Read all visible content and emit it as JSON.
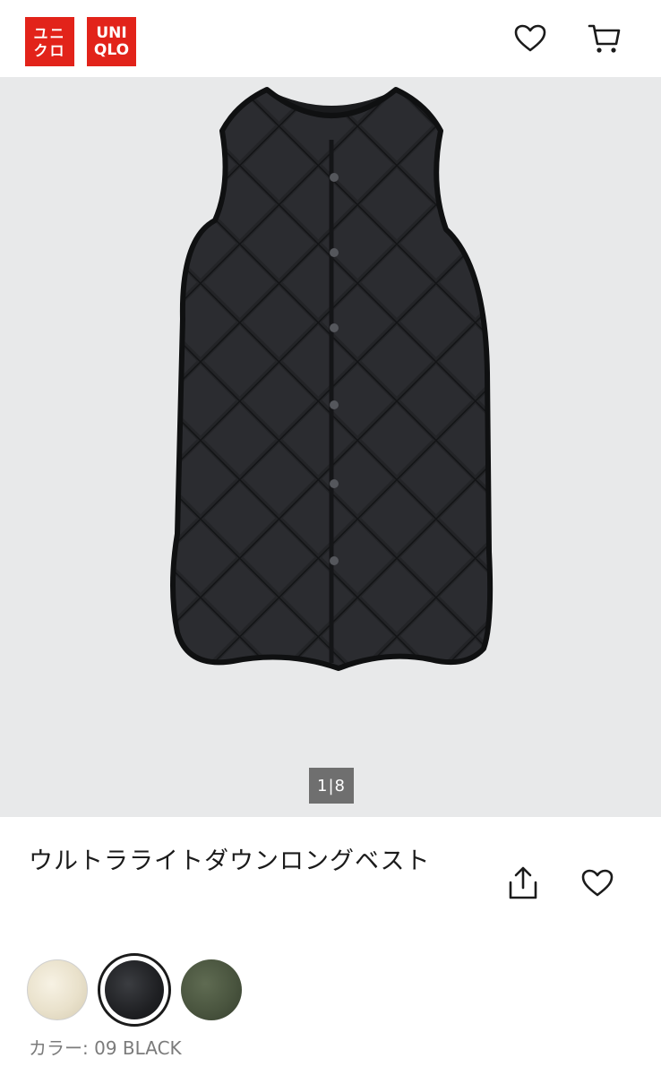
{
  "header": {
    "logo_top_jp": "ユニ",
    "logo_bottom_jp": "クロ",
    "logo_top_en": "UNI",
    "logo_bottom_en": "QLO",
    "favorite_icon": "heart-icon",
    "cart_icon": "cart-icon"
  },
  "gallery": {
    "counter": "1|8"
  },
  "product": {
    "title": "ウルトラライトダウンロングベスト",
    "share_icon": "share-icon",
    "favorite_icon": "heart-icon"
  },
  "colors": {
    "options": [
      "cream",
      "black",
      "olive"
    ],
    "selected_index": 1,
    "label_prefix": "カラー:",
    "label_value": "09 BLACK"
  },
  "theme": {
    "brand_red": "#e2231a",
    "hero_background": "#e8e9ea",
    "counter_background": "#6f6f6f"
  }
}
